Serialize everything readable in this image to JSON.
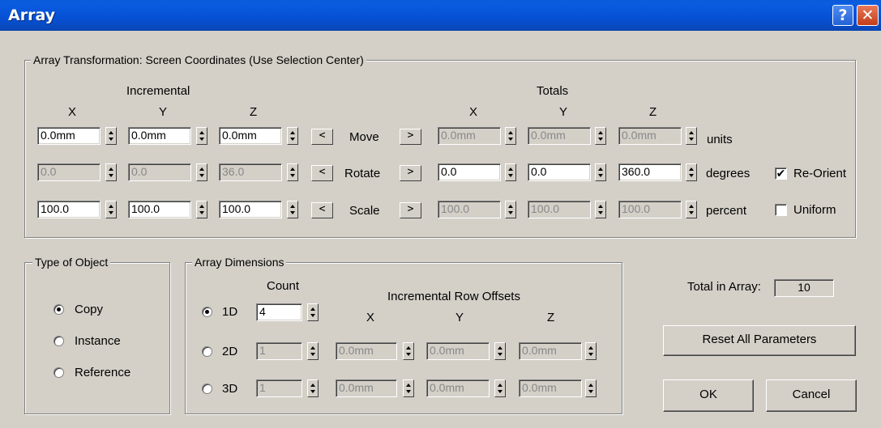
{
  "window": {
    "title": "Array",
    "help_label": "?",
    "close_label": "✕",
    "help_icon": "help-icon",
    "close_icon": "close-icon"
  },
  "transform": {
    "group_label": "Array Transformation: Screen Coordinates (Use Selection Center)",
    "incremental_label": "Incremental",
    "totals_label": "Totals",
    "axis_x": "X",
    "axis_y": "Y",
    "axis_z": "Z",
    "move": {
      "label": "Move",
      "inc": [
        "0.0mm",
        "0.0mm",
        "0.0mm"
      ],
      "tot": [
        "0.0mm",
        "0.0mm",
        "0.0mm"
      ],
      "unit": "units"
    },
    "rotate": {
      "label": "Rotate",
      "inc": [
        "0.0",
        "0.0",
        "36.0"
      ],
      "tot": [
        "0.0",
        "0.0",
        "360.0"
      ],
      "unit": "degrees"
    },
    "scale": {
      "label": "Scale",
      "inc": [
        "100.0",
        "100.0",
        "100.0"
      ],
      "tot": [
        "100.0",
        "100.0",
        "100.0"
      ],
      "unit": "percent"
    },
    "left_arrow": "<",
    "right_arrow": ">",
    "reorient_label": "Re-Orient",
    "reorient_checked": true,
    "reorient_mark": "✔",
    "uniform_label": "Uniform",
    "uniform_checked": false
  },
  "type_of_object": {
    "group_label": "Type of Object",
    "options": [
      "Copy",
      "Instance",
      "Reference"
    ],
    "selected": "Copy"
  },
  "dimensions": {
    "group_label": "Array Dimensions",
    "count_label": "Count",
    "offsets_label": "Incremental Row Offsets",
    "axis_x": "X",
    "axis_y": "Y",
    "axis_z": "Z",
    "rows": [
      {
        "label": "1D",
        "count": "4"
      },
      {
        "label": "2D",
        "count": "1",
        "offsets": [
          "0.0mm",
          "0.0mm",
          "0.0mm"
        ]
      },
      {
        "label": "3D",
        "count": "1",
        "offsets": [
          "0.0mm",
          "0.0mm",
          "0.0mm"
        ]
      }
    ],
    "selected": "1D"
  },
  "summary": {
    "total_label": "Total in Array:",
    "total_value": "10"
  },
  "buttons": {
    "reset": "Reset All Parameters",
    "ok": "OK",
    "cancel": "Cancel"
  }
}
